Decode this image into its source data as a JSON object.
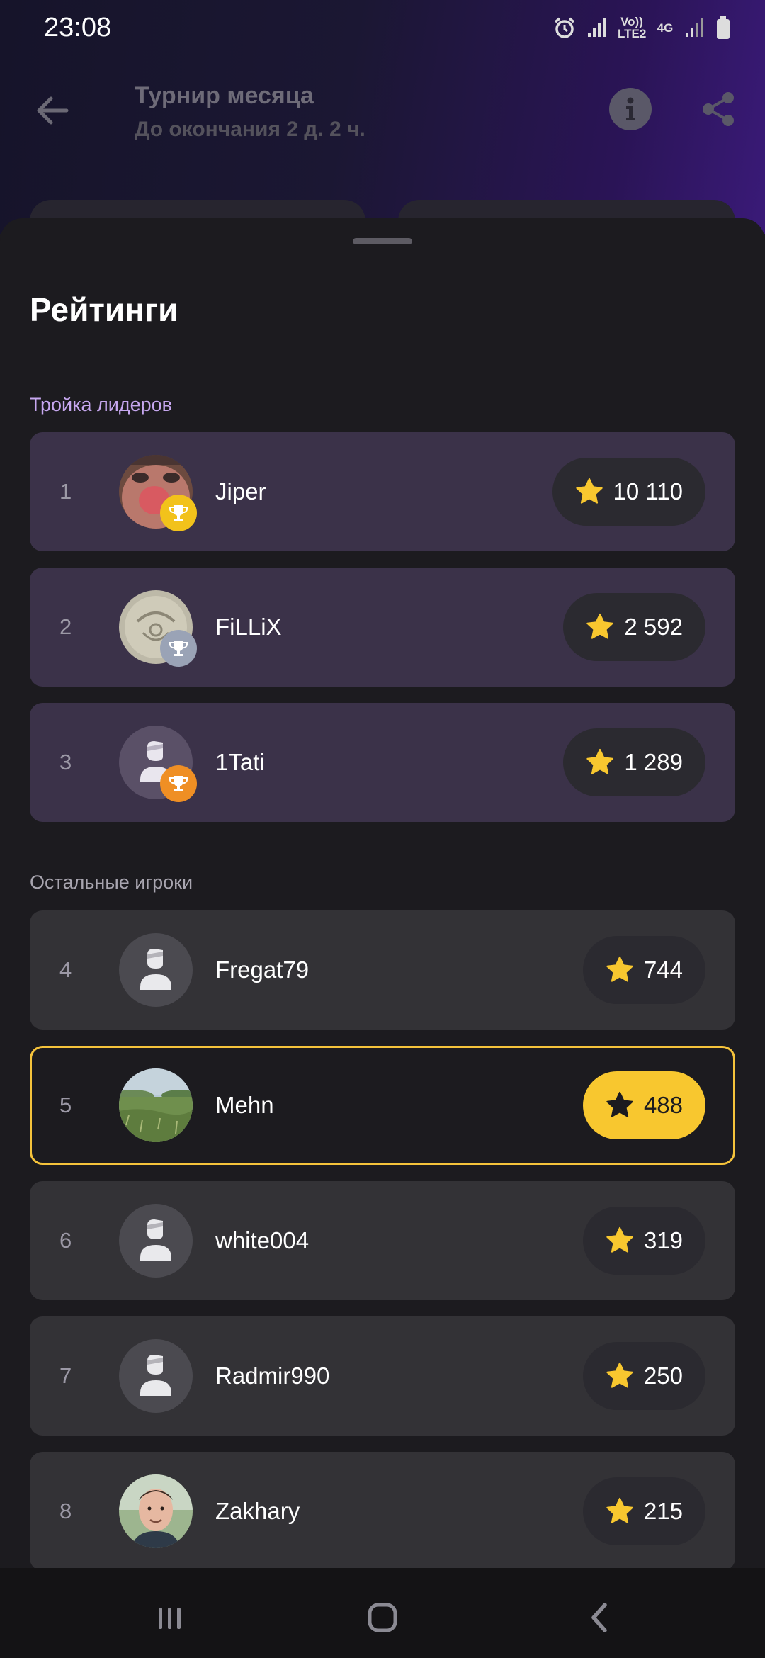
{
  "status_bar": {
    "time": "23:08",
    "network_labels": [
      "Vo)) LTE2",
      "4G"
    ],
    "icons": [
      "alarm-icon",
      "signal-icon",
      "network-type-icon",
      "signal-icon",
      "battery-icon"
    ]
  },
  "appbar": {
    "title": "Турнир месяца",
    "subtitle": "До окончания 2 д. 2 ч.",
    "icons": [
      "back-arrow-icon",
      "info-icon",
      "share-icon"
    ]
  },
  "sheet": {
    "title": "Рейтинги",
    "top_section_label": "Тройка лидеров",
    "other_section_label": "Остальные игроки",
    "top_players": [
      {
        "rank": "1",
        "name": "Jiper",
        "score": "10 110",
        "trophy": "gold"
      },
      {
        "rank": "2",
        "name": "FiLLiX",
        "score": "2 592",
        "trophy": "silver"
      },
      {
        "rank": "3",
        "name": "1Tati",
        "score": "1 289",
        "trophy": "bronze"
      }
    ],
    "other_players": [
      {
        "rank": "4",
        "name": "Fregat79",
        "score": "744"
      },
      {
        "rank": "5",
        "name": "Mehn",
        "score": "488",
        "current_user": true
      },
      {
        "rank": "6",
        "name": "white004",
        "score": "319"
      },
      {
        "rank": "7",
        "name": "Radmir990",
        "score": "250"
      },
      {
        "rank": "8",
        "name": "Zakhary",
        "score": "215"
      }
    ]
  },
  "colors": {
    "accent": "#f5c33b",
    "top_row_bg": "#3b3249",
    "row_bg": "#333236",
    "section_top": "#c6a7ef",
    "section_other": "#a9a6b0",
    "gold": "#f2c21b",
    "silver": "#9aa3b6",
    "bronze": "#ef8f24"
  },
  "navbar": {
    "icons": [
      "recent-apps-icon",
      "home-icon",
      "back-icon"
    ]
  }
}
